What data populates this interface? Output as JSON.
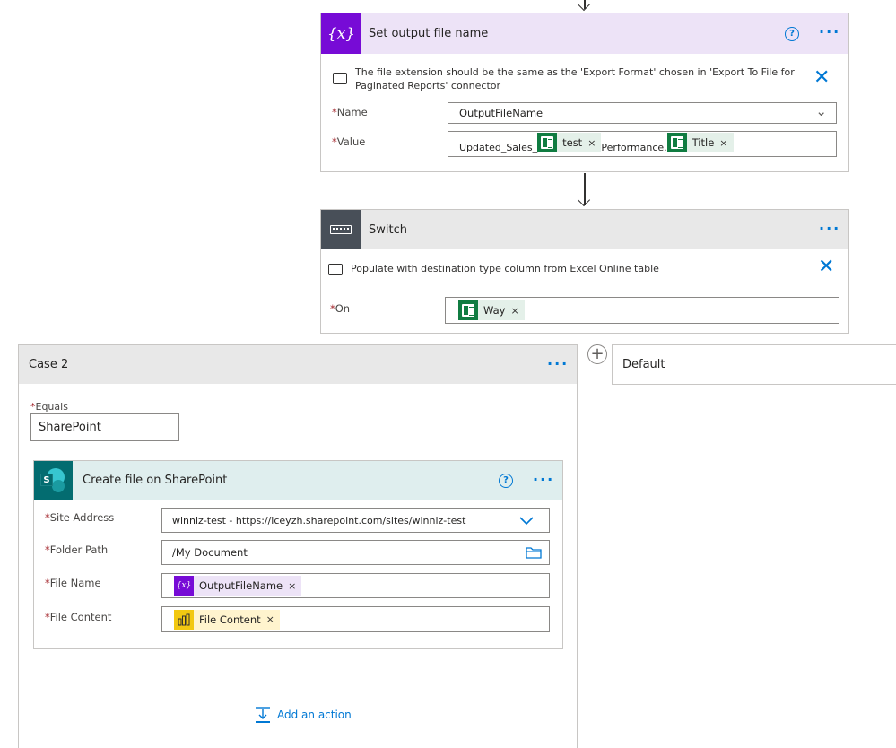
{
  "set_var": {
    "title": "Set output file name",
    "icon_text": "{x}",
    "note": "The file extension should be the same as the 'Export Format' chosen in 'Export To File for Paginated Reports' connector",
    "name_label": "Name",
    "name_value": "OutputFileName",
    "value_label": "Value",
    "value_prefix": "Updated_Sales_",
    "token_test": "test",
    "value_middle": "Performance.",
    "token_title": "Title",
    "colors": {
      "header_bg": "#ede3f7",
      "icon_bg": "#770bd6"
    }
  },
  "switch": {
    "title": "Switch",
    "note": "Populate with destination type column from Excel Online table",
    "on_label": "On",
    "token_way": "Way",
    "colors": {
      "header_bg": "#e8e8e8",
      "icon_bg": "#484f58"
    }
  },
  "case2": {
    "title": "Case 2",
    "equals_label": "Equals",
    "equals_value": "SharePoint",
    "add_action": "Add an action"
  },
  "default_case": {
    "title": "Default"
  },
  "sharepoint": {
    "title": "Create file on SharePoint",
    "icon_letter": "S",
    "site_label": "Site Address",
    "site_value": "winniz-test - https://iceyzh.sharepoint.com/sites/winniz-test",
    "folder_label": "Folder Path",
    "folder_value": "/My Document",
    "filename_label": "File Name",
    "filename_token": "OutputFileName",
    "filename_token_icon": "{x}",
    "content_label": "File Content",
    "content_token": "File Content",
    "colors": {
      "header_bg": "#dfeeee",
      "icon_bg": "#036c70"
    }
  },
  "icons": {
    "more": "···",
    "help": "?",
    "close": "✕",
    "remove": "×",
    "chevron": "⌄",
    "plus": "+"
  }
}
